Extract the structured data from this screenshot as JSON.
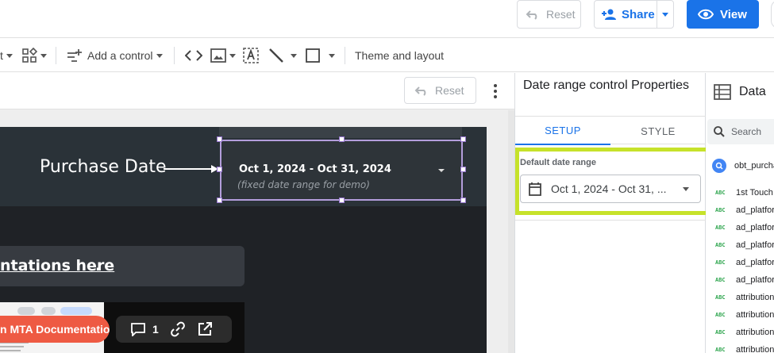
{
  "header": {
    "reset_label": "Reset",
    "share_label": "Share",
    "view_label": "View"
  },
  "toolbar": {
    "cut_label": "t",
    "add_control_label": "Add a control",
    "theme_label": "Theme and layout"
  },
  "canvas": {
    "reset_label": "Reset",
    "purchase_date_label": "Purchase Date",
    "date_range_value": "Oct 1, 2024 - Oct 31, 2024",
    "date_range_note": "(fixed date range for demo)",
    "doc_link_text": "ntations here",
    "doc_link_dot": ".",
    "mta_button": "n MTA Documentatio",
    "comment_count": "1"
  },
  "properties": {
    "title": "Date range control Properties",
    "tab_setup": "SETUP",
    "tab_style": "STYLE",
    "default_range_label": "Default date range",
    "default_range_value": "Oct 1, 2024 - Oct 31, ..."
  },
  "data_panel": {
    "title": "Data",
    "search_placeholder": "Search",
    "source": "obt_purcha",
    "field_type": "ABC",
    "fields": [
      "1st Touch",
      "ad_platfor",
      "ad_platfor",
      "ad_platfor",
      "ad_platfor",
      "ad_platfor",
      "attribution",
      "attribution",
      "attribution",
      "attribution"
    ]
  },
  "colors": {
    "primary": "#1a73e8",
    "highlight": "#c6e22a",
    "mta_orange": "#ee5a43",
    "selection": "#b39ddb"
  }
}
